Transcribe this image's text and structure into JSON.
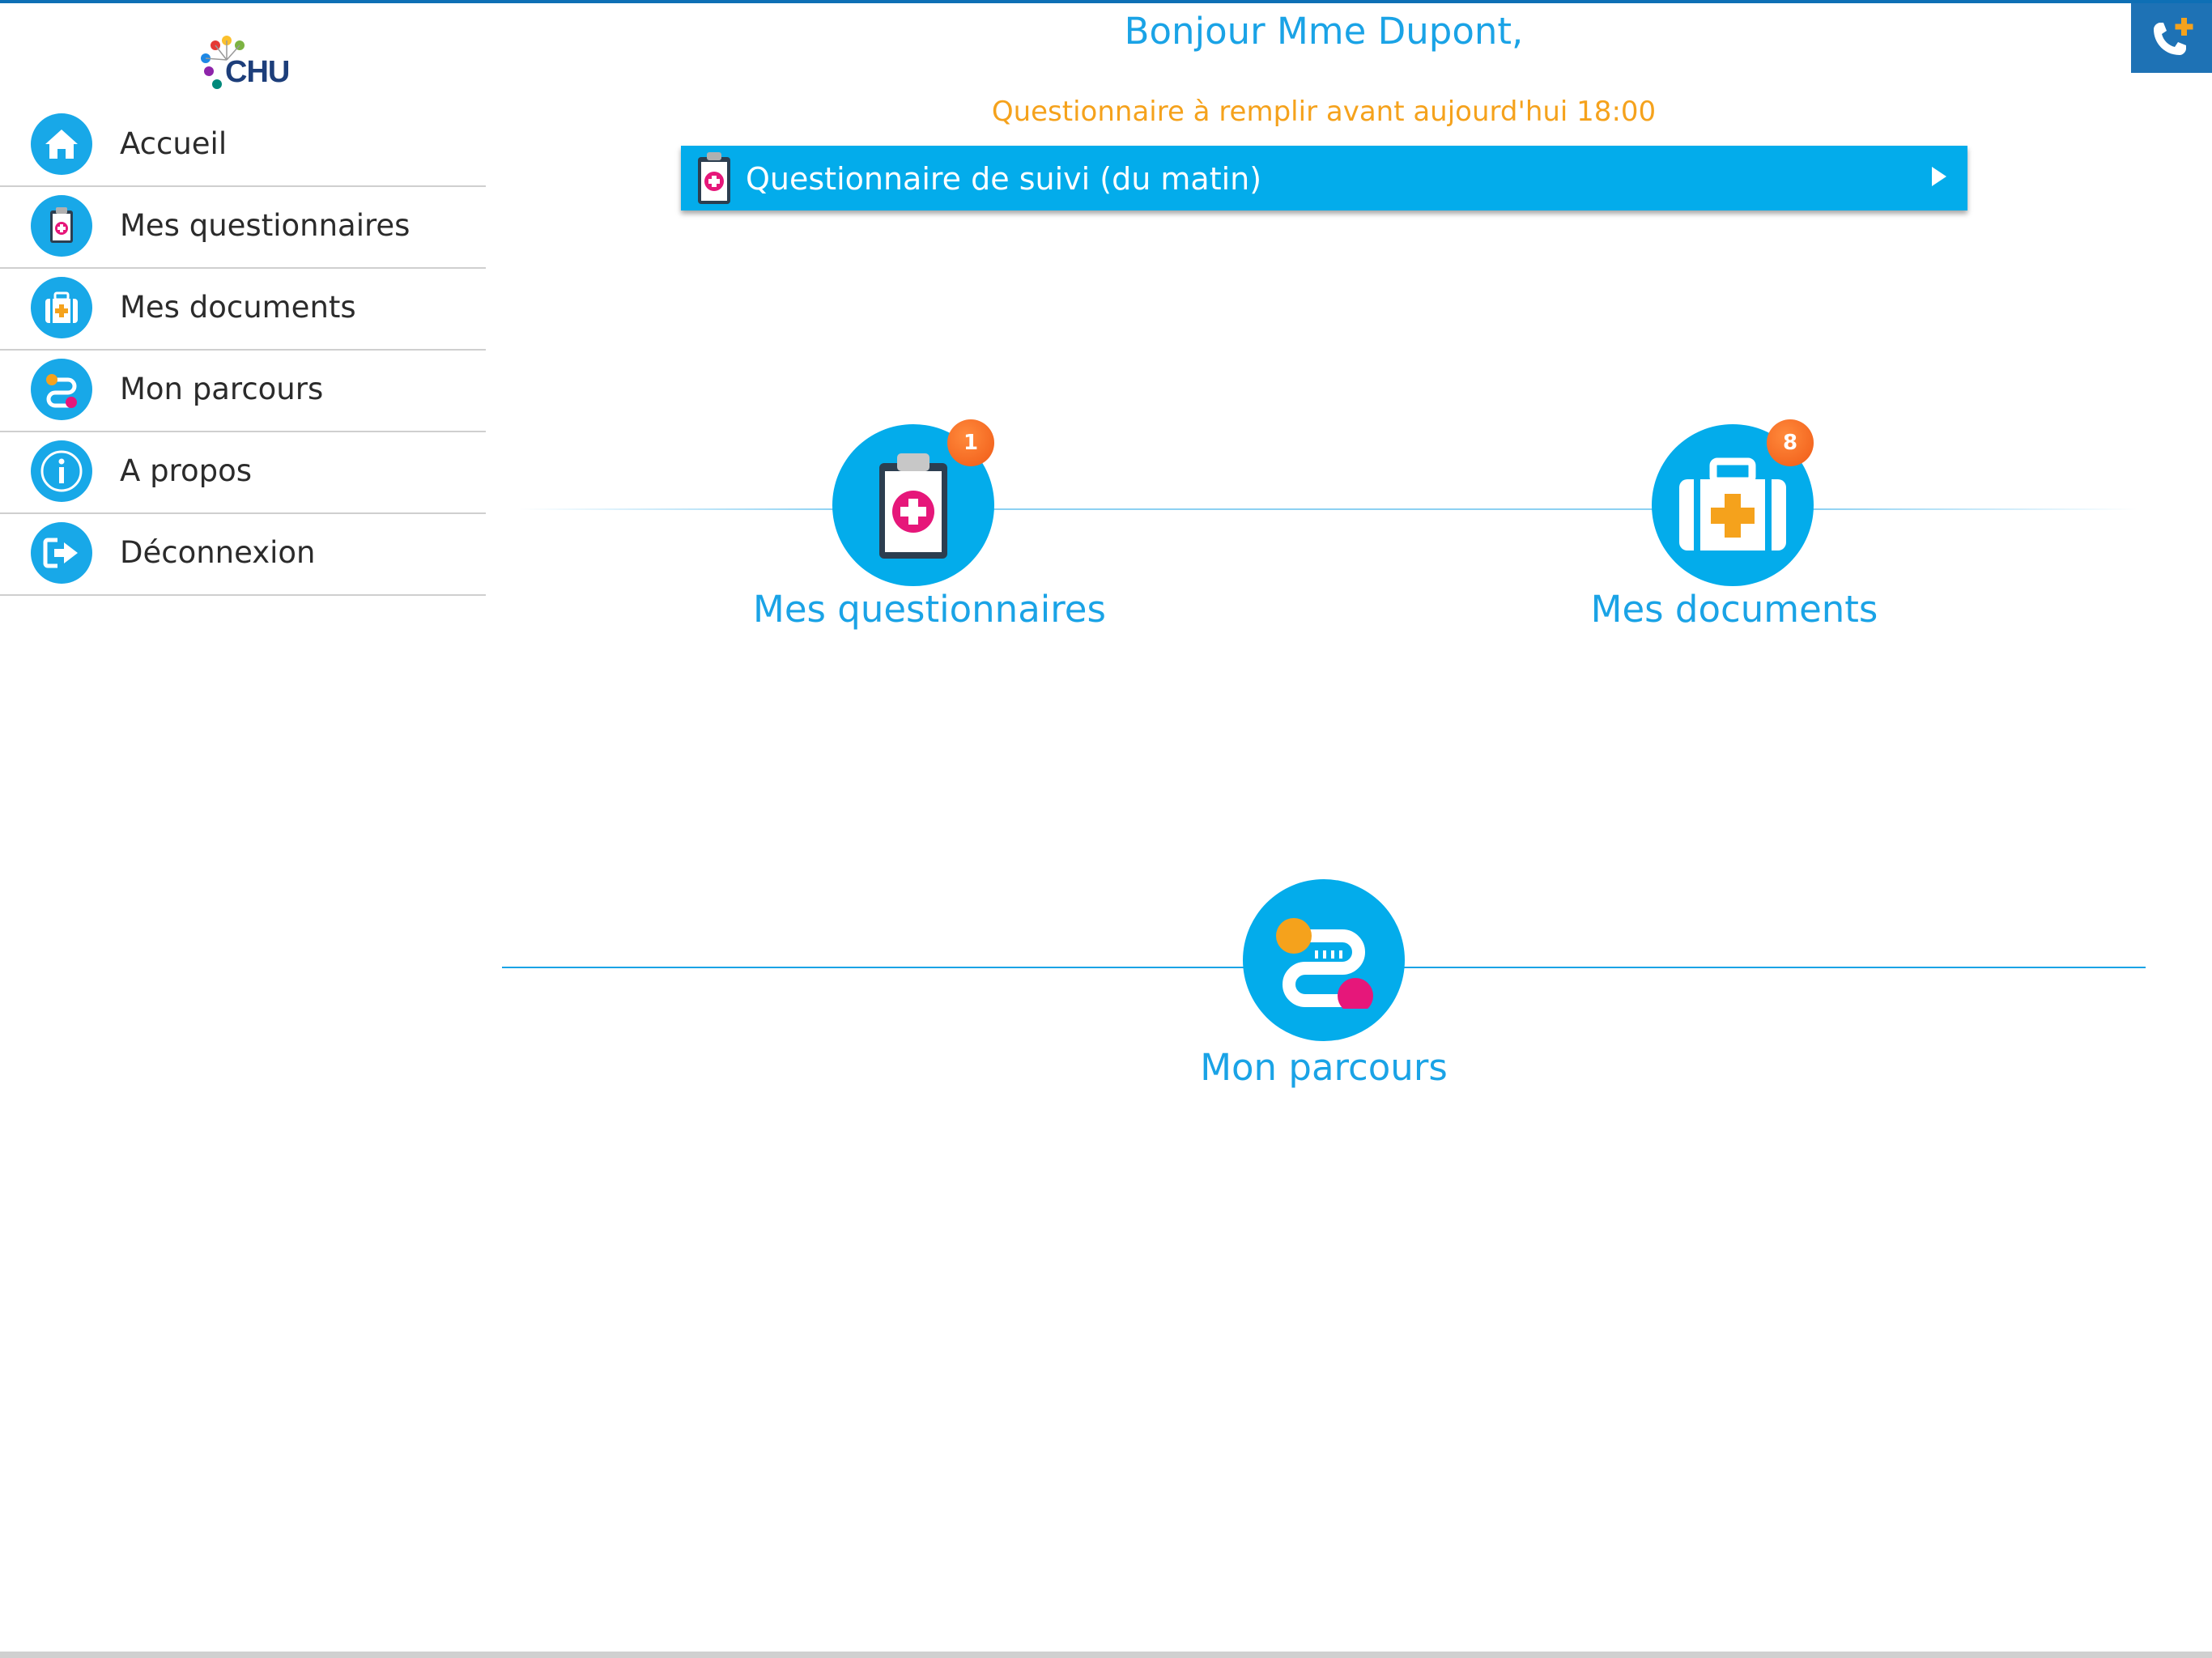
{
  "app": {
    "logo_text": "CHU",
    "greeting": "Bonjour Mme Dupont,",
    "due_notice": "Questionnaire à remplir avant aujourd'hui 18:00"
  },
  "sidebar": {
    "items": [
      {
        "label": "Accueil",
        "icon": "home-icon"
      },
      {
        "label": "Mes questionnaires",
        "icon": "clipboard-icon"
      },
      {
        "label": "Mes documents",
        "icon": "medical-bag-icon"
      },
      {
        "label": "Mon parcours",
        "icon": "path-icon"
      },
      {
        "label": "A propos",
        "icon": "info-icon"
      },
      {
        "label": "Déconnexion",
        "icon": "logout-icon"
      }
    ]
  },
  "questionnaire_bar": {
    "label": "Questionnaire de suivi (du matin)",
    "icon": "clipboard-icon"
  },
  "tiles": {
    "questionnaires": {
      "label": "Mes questionnaires",
      "badge": "1"
    },
    "documents": {
      "label": "Mes documents",
      "badge": "8"
    },
    "parcours": {
      "label": "Mon parcours"
    }
  },
  "colors": {
    "accent": "#03aceb",
    "text_accent": "#1aa3e6",
    "warning": "#f5a21c",
    "badge": "#f05a16",
    "pink": "#e6177a",
    "call_button": "#1e72b5"
  }
}
